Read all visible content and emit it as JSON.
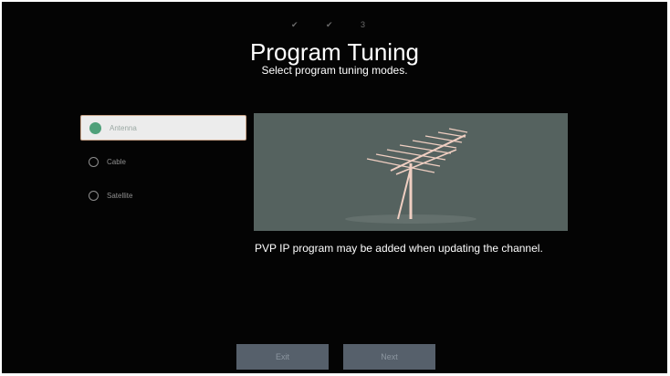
{
  "steps": "✔ ✔ 3",
  "header": {
    "title": "Program Tuning",
    "subtitle": "Select program tuning modes."
  },
  "modes": [
    {
      "label": "Antenna",
      "selected": true
    },
    {
      "label": "Cable",
      "selected": false
    },
    {
      "label": "Satellite",
      "selected": false
    }
  ],
  "preview": {
    "icon": "antenna-icon"
  },
  "note": "PVP IP program may be added when updating the channel.",
  "buttons": {
    "exit": "Exit",
    "next": "Next"
  },
  "colors": {
    "background": "#040404",
    "selected_radio": "#4fa07a",
    "preview_bg": "#55625f",
    "antenna": "#f0cfc2",
    "button_bg": "#56606b"
  }
}
